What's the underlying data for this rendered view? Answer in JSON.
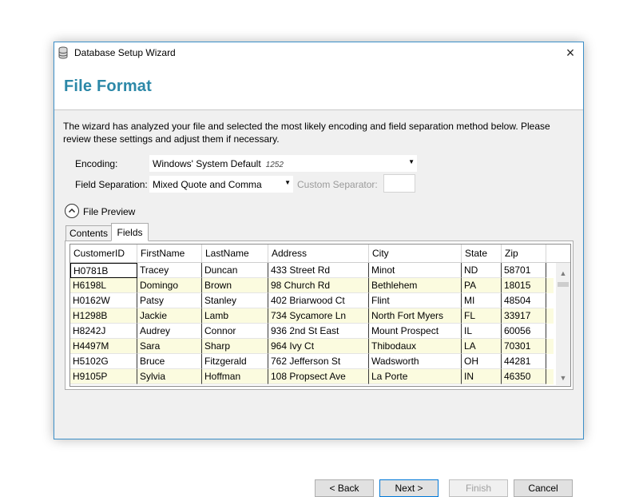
{
  "window": {
    "title": "Database Setup Wizard",
    "close_glyph": "×"
  },
  "header": {
    "title": "File Format"
  },
  "description": "The wizard has analyzed your file and selected the most likely encoding and field separation method below.  Please review these settings and adjust them if necessary.",
  "encoding": {
    "label": "Encoding:",
    "value": "Windows' System Default",
    "codepage": "1252"
  },
  "field_separation": {
    "label": "Field Separation:",
    "value": "Mixed Quote and Comma"
  },
  "custom_separator": {
    "label": "Custom Separator:",
    "value": ""
  },
  "preview": {
    "label": "File Preview",
    "expanded": true
  },
  "tabs": [
    {
      "label": "Contents",
      "active": false
    },
    {
      "label": "Fields",
      "active": true
    }
  ],
  "table": {
    "columns": [
      "CustomerID",
      "FirstName",
      "LastName",
      "Address",
      "City",
      "State",
      "Zip"
    ],
    "rows": [
      [
        "H0781B",
        "Tracey",
        "Duncan",
        "433 Street Rd",
        "Minot",
        "ND",
        "58701"
      ],
      [
        "H6198L",
        "Domingo",
        "Brown",
        "98 Church Rd",
        "Bethlehem",
        "PA",
        "18015"
      ],
      [
        "H0162W",
        "Patsy",
        "Stanley",
        "402 Briarwood Ct",
        "Flint",
        "MI",
        "48504"
      ],
      [
        "H1298B",
        "Jackie",
        "Lamb",
        "734 Sycamore Ln",
        "North Fort Myers",
        "FL",
        "33917"
      ],
      [
        "H8242J",
        "Audrey",
        "Connor",
        "936 2nd St East",
        "Mount Prospect",
        "IL",
        "60056"
      ],
      [
        "H4497M",
        "Sara",
        "Sharp",
        "964 Ivy Ct",
        "Thibodaux",
        "LA",
        "70301"
      ],
      [
        "H5102G",
        "Bruce",
        "Fitzgerald",
        "762 Jefferson St",
        "Wadsworth",
        "OH",
        "44281"
      ],
      [
        "H9105P",
        "Sylvia",
        "Hoffman",
        "108 Propsect Ave",
        "La Porte",
        "IN",
        "46350"
      ]
    ]
  },
  "buttons": {
    "back": "< Back",
    "next": "Next >",
    "finish": "Finish",
    "cancel": "Cancel"
  },
  "colors": {
    "accent": "#2c88a8",
    "row_alt": "#fbfbdf",
    "window_border": "#3c8fc8"
  }
}
